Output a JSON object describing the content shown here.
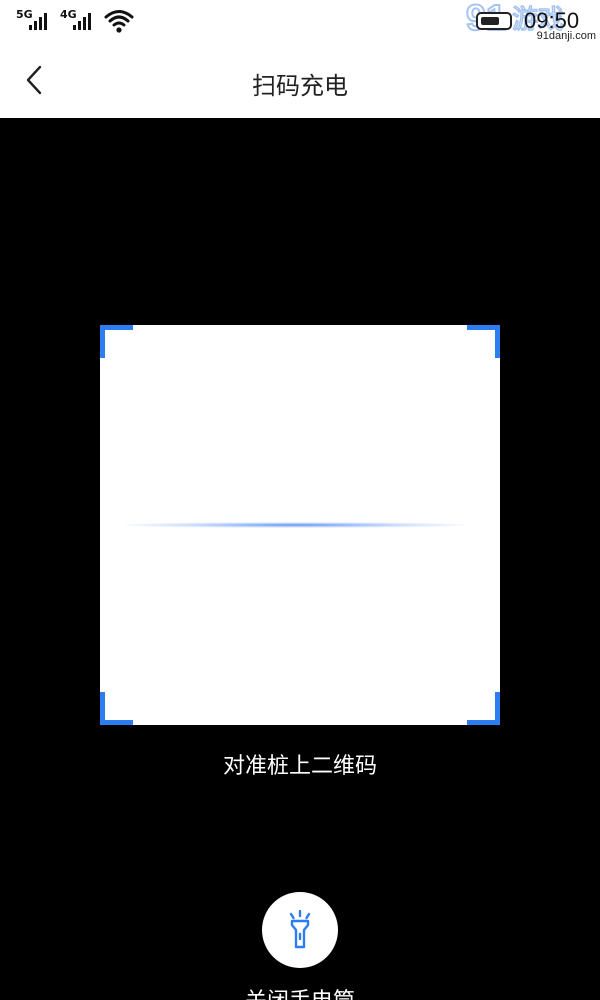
{
  "status_bar": {
    "signal_1": "5G",
    "signal_2": "4G",
    "time": "09:50",
    "watermark_logo": "91游戏",
    "watermark_site": "91danji.com",
    "icons": [
      "signal-icon",
      "signal-icon",
      "wifi-icon",
      "battery-icon"
    ]
  },
  "header": {
    "title": "扫码充电",
    "back_icon": "chevron-left-icon"
  },
  "scanner": {
    "hint": "对准桩上二维码",
    "accent_color": "#2d7df0"
  },
  "flashlight": {
    "label": "关闭手电筒",
    "icon": "flashlight-icon"
  }
}
